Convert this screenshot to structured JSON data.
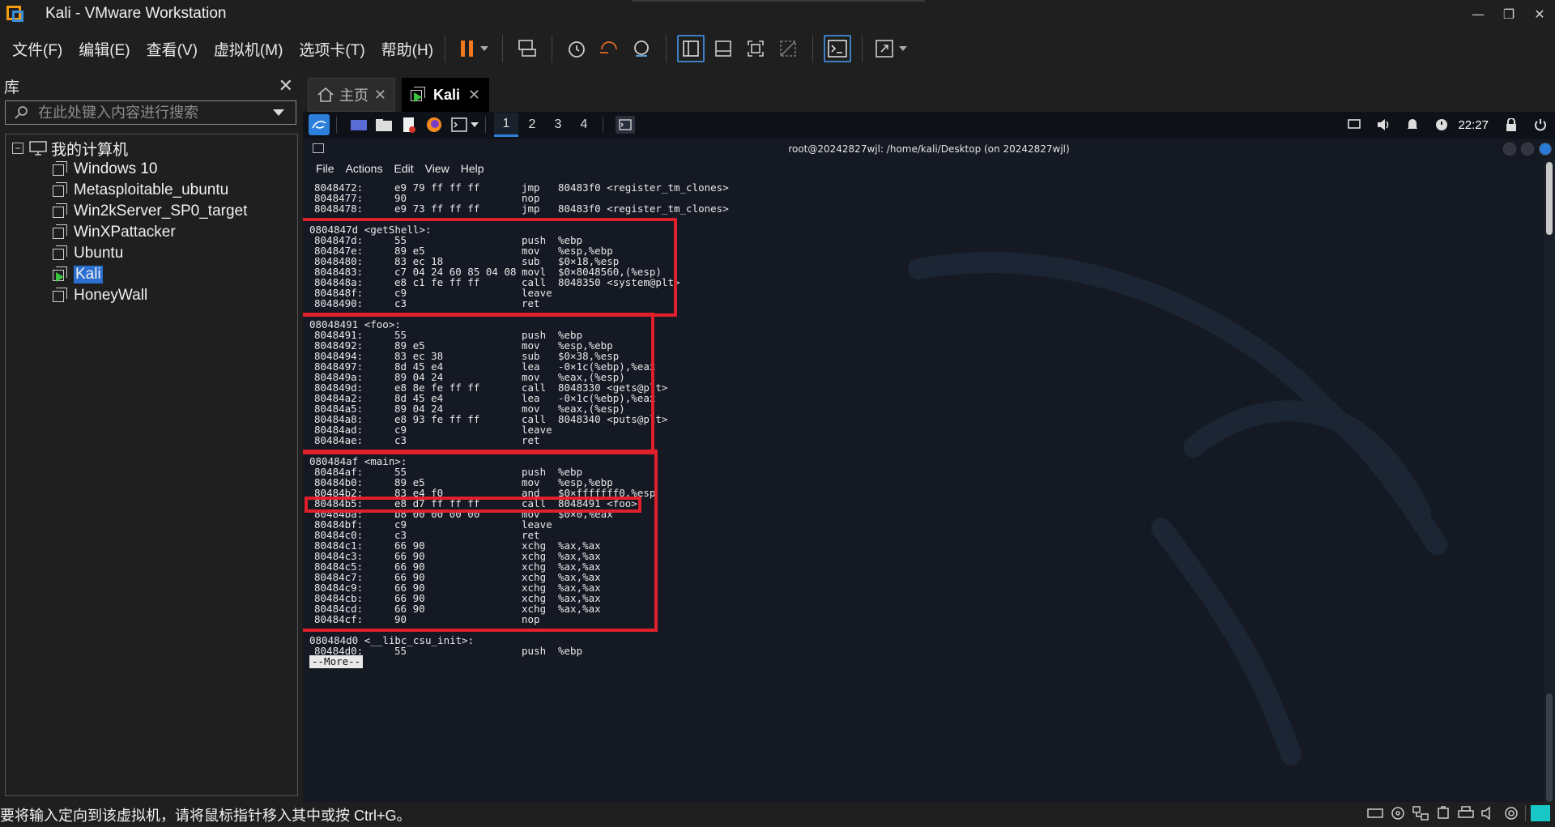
{
  "window": {
    "title": "Kali - VMware Workstation",
    "minimize": "—",
    "restore": "❐",
    "close": "✕"
  },
  "menubar": {
    "items": [
      "文件(F)",
      "编辑(E)",
      "查看(V)",
      "虚拟机(M)",
      "选项卡(T)",
      "帮助(H)"
    ]
  },
  "toolbar": {
    "icons": [
      "pause-icon",
      "send-ctrl-alt-del-icon",
      "snapshot-icon",
      "revert-snapshot-icon",
      "snapshot-manager-icon",
      "library-view-icon",
      "thumbnail-view-icon",
      "fullscreen-icon",
      "unity-icon",
      "console-view-icon",
      "stretch-icon"
    ],
    "pause_color": "#f0781e"
  },
  "library": {
    "title": "库",
    "close": "✕",
    "search_placeholder": "在此处键入内容进行搜索",
    "root": {
      "expander": "−",
      "label": "我的计算机"
    },
    "vms": [
      "Windows 10",
      "Metasploitable_ubuntu",
      "Win2kServer_SP0_target",
      "WinXPattacker",
      "Ubuntu",
      "Kali",
      "HoneyWall"
    ],
    "selected": "Kali"
  },
  "tabs": [
    {
      "label": "主页",
      "close": "✕",
      "icon": "home-icon"
    },
    {
      "label": "Kali",
      "close": "✕",
      "icon": "vm-running-icon"
    }
  ],
  "kali_panel": {
    "workspaces": [
      "1",
      "2",
      "3",
      "4"
    ],
    "active_workspace": "1",
    "clock": "22:27"
  },
  "terminal": {
    "title": "root@20242827wjl: /home/kali/Desktop (on 20242827wjl)",
    "menu": [
      "File",
      "Actions",
      "Edit",
      "View",
      "Help"
    ],
    "more": "--More--"
  },
  "disasm": [
    {
      "type": "ins",
      "addr": "8048472:",
      "bytes": "e9 79 ff ff ff",
      "mn": "jmp",
      "op": "80483f0 <register_tm_clones>"
    },
    {
      "type": "ins",
      "addr": "8048477:",
      "bytes": "90",
      "mn": "nop",
      "op": ""
    },
    {
      "type": "ins",
      "addr": "8048478:",
      "bytes": "e9 73 ff ff ff",
      "mn": "jmp",
      "op": "80483f0 <register_tm_clones>"
    },
    {
      "type": "blank"
    },
    {
      "type": "label",
      "text": "0804847d <getShell>:"
    },
    {
      "type": "ins",
      "addr": "804847d:",
      "bytes": "55",
      "mn": "push",
      "op": "%ebp"
    },
    {
      "type": "ins",
      "addr": "804847e:",
      "bytes": "89 e5",
      "mn": "mov",
      "op": "%esp,%ebp"
    },
    {
      "type": "ins",
      "addr": "8048480:",
      "bytes": "83 ec 18",
      "mn": "sub",
      "op": "$0×18,%esp"
    },
    {
      "type": "ins",
      "addr": "8048483:",
      "bytes": "c7 04 24 60 85 04 08",
      "mn": "movl",
      "op": "$0×8048560,(%esp)"
    },
    {
      "type": "ins",
      "addr": "804848a:",
      "bytes": "e8 c1 fe ff ff",
      "mn": "call",
      "op": "8048350 <system@plt>"
    },
    {
      "type": "ins",
      "addr": "804848f:",
      "bytes": "c9",
      "mn": "leave",
      "op": ""
    },
    {
      "type": "ins",
      "addr": "8048490:",
      "bytes": "c3",
      "mn": "ret",
      "op": ""
    },
    {
      "type": "blank"
    },
    {
      "type": "label",
      "text": "08048491 <foo>:"
    },
    {
      "type": "ins",
      "addr": "8048491:",
      "bytes": "55",
      "mn": "push",
      "op": "%ebp"
    },
    {
      "type": "ins",
      "addr": "8048492:",
      "bytes": "89 e5",
      "mn": "mov",
      "op": "%esp,%ebp"
    },
    {
      "type": "ins",
      "addr": "8048494:",
      "bytes": "83 ec 38",
      "mn": "sub",
      "op": "$0×38,%esp"
    },
    {
      "type": "ins",
      "addr": "8048497:",
      "bytes": "8d 45 e4",
      "mn": "lea",
      "op": "-0×1c(%ebp),%eax"
    },
    {
      "type": "ins",
      "addr": "804849a:",
      "bytes": "89 04 24",
      "mn": "mov",
      "op": "%eax,(%esp)"
    },
    {
      "type": "ins",
      "addr": "804849d:",
      "bytes": "e8 8e fe ff ff",
      "mn": "call",
      "op": "8048330 <gets@plt>"
    },
    {
      "type": "ins",
      "addr": "80484a2:",
      "bytes": "8d 45 e4",
      "mn": "lea",
      "op": "-0×1c(%ebp),%eax"
    },
    {
      "type": "ins",
      "addr": "80484a5:",
      "bytes": "89 04 24",
      "mn": "mov",
      "op": "%eax,(%esp)"
    },
    {
      "type": "ins",
      "addr": "80484a8:",
      "bytes": "e8 93 fe ff ff",
      "mn": "call",
      "op": "8048340 <puts@plt>"
    },
    {
      "type": "ins",
      "addr": "80484ad:",
      "bytes": "c9",
      "mn": "leave",
      "op": ""
    },
    {
      "type": "ins",
      "addr": "80484ae:",
      "bytes": "c3",
      "mn": "ret",
      "op": ""
    },
    {
      "type": "blank"
    },
    {
      "type": "label",
      "text": "080484af <main>:"
    },
    {
      "type": "ins",
      "addr": "80484af:",
      "bytes": "55",
      "mn": "push",
      "op": "%ebp"
    },
    {
      "type": "ins",
      "addr": "80484b0:",
      "bytes": "89 e5",
      "mn": "mov",
      "op": "%esp,%ebp"
    },
    {
      "type": "ins",
      "addr": "80484b2:",
      "bytes": "83 e4 f0",
      "mn": "and",
      "op": "$0×fffffff0,%esp"
    },
    {
      "type": "ins",
      "addr": "80484b5:",
      "bytes": "e8 d7 ff ff ff",
      "mn": "call",
      "op": "8048491 <foo>"
    },
    {
      "type": "ins",
      "addr": "80484ba:",
      "bytes": "b8 00 00 00 00",
      "mn": "mov",
      "op": "$0×0,%eax"
    },
    {
      "type": "ins",
      "addr": "80484bf:",
      "bytes": "c9",
      "mn": "leave",
      "op": ""
    },
    {
      "type": "ins",
      "addr": "80484c0:",
      "bytes": "c3",
      "mn": "ret",
      "op": ""
    },
    {
      "type": "ins",
      "addr": "80484c1:",
      "bytes": "66 90",
      "mn": "xchg",
      "op": "%ax,%ax"
    },
    {
      "type": "ins",
      "addr": "80484c3:",
      "bytes": "66 90",
      "mn": "xchg",
      "op": "%ax,%ax"
    },
    {
      "type": "ins",
      "addr": "80484c5:",
      "bytes": "66 90",
      "mn": "xchg",
      "op": "%ax,%ax"
    },
    {
      "type": "ins",
      "addr": "80484c7:",
      "bytes": "66 90",
      "mn": "xchg",
      "op": "%ax,%ax"
    },
    {
      "type": "ins",
      "addr": "80484c9:",
      "bytes": "66 90",
      "mn": "xchg",
      "op": "%ax,%ax"
    },
    {
      "type": "ins",
      "addr": "80484cb:",
      "bytes": "66 90",
      "mn": "xchg",
      "op": "%ax,%ax"
    },
    {
      "type": "ins",
      "addr": "80484cd:",
      "bytes": "66 90",
      "mn": "xchg",
      "op": "%ax,%ax"
    },
    {
      "type": "ins",
      "addr": "80484cf:",
      "bytes": "90",
      "mn": "nop",
      "op": ""
    },
    {
      "type": "blank"
    },
    {
      "type": "label",
      "text": "080484d0 <__libc_csu_init>:"
    },
    {
      "type": "ins",
      "addr": "80484d0:",
      "bytes": "55",
      "mn": "push",
      "op": "%ebp"
    }
  ],
  "annotation_color": "#e0202a",
  "statusbar": {
    "text": "要将输入定向到该虚拟机，请将鼠标指针移入其中或按 Ctrl+G。",
    "icons": [
      "hdd-icon",
      "cd-icon",
      "network-icon",
      "usb-icon",
      "printer-icon",
      "sound-icon",
      "display-icon",
      "message-icon"
    ]
  }
}
